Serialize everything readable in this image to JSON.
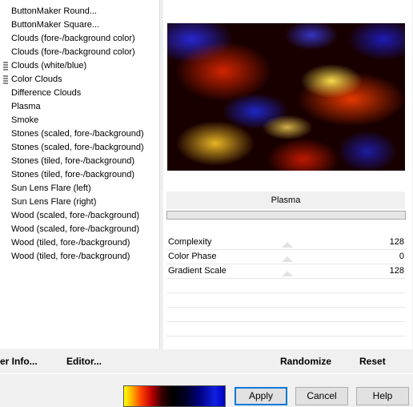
{
  "effects_list": {
    "items": [
      "ButtonMaker Round...",
      "ButtonMaker Square...",
      "Clouds (fore-/background color)",
      "Clouds (fore-/background color)",
      "Clouds (white/blue)",
      "Color Clouds",
      "Difference Clouds",
      "Plasma",
      "Smoke",
      "Stones (scaled, fore-/background)",
      "Stones (scaled, fore-/background)",
      "Stones (tiled, fore-/background)",
      "Stones (tiled, fore-/background)",
      "Sun Lens Flare (left)",
      "Sun Lens Flare (right)",
      "Wood (scaled, fore-/background)",
      "Wood (scaled, fore-/background)",
      "Wood (tiled, fore-/background)",
      "Wood (tiled, fore-/background)"
    ],
    "selected": "Plasma"
  },
  "params": {
    "title": "Plasma",
    "rows": [
      {
        "label": "Complexity",
        "value": "128"
      },
      {
        "label": "Color Phase",
        "value": "0"
      },
      {
        "label": "Gradient Scale",
        "value": "128"
      }
    ]
  },
  "actions": {
    "filter_info": "er Info...",
    "editor": "Editor...",
    "randomize": "Randomize",
    "reset": "Reset"
  },
  "buttons": {
    "apply": "Apply",
    "cancel": "Cancel",
    "help": "Help"
  },
  "preview": {
    "gradient_colors": [
      "#ffff00",
      "#ff4000",
      "#000000",
      "#000080",
      "#1020e0"
    ]
  }
}
